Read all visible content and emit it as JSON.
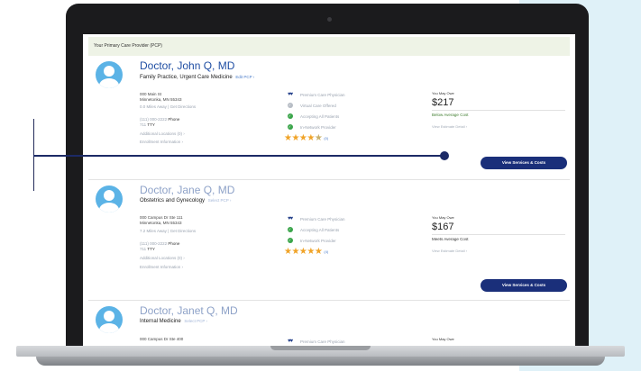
{
  "pcp_header": "Your Primary Care Provider (PCP)",
  "providers": [
    {
      "name": "Doctor, John Q, MD",
      "specialty": "Family Practice, Urgent Care Medicine",
      "pcp_link": "Edit PCP ›",
      "address_line1": "000 Main St",
      "address_line2": "Minnetonka, MN 55343",
      "distance": "0.0 Miles Away | Get Directions",
      "phone": "(111) 000-2222",
      "phone_label": "Phone",
      "tty": "711",
      "tty_label": "TTY",
      "additional_locations": "Additional Locations (0) ›",
      "enrollment": "Enrollment Information ›",
      "features": [
        "Premium Care Physician",
        "Virtual Care Offered",
        "Accepting All Patients",
        "In-Network Provider"
      ],
      "rating_count": "(0)",
      "rating": 4.5,
      "owe_label": "You May Owe",
      "cost": "$217",
      "cost_note": "Below Average Cost",
      "estimate_link": "View Estimate Detail ›",
      "button": "View Services & Costs"
    },
    {
      "name": "Doctor, Jane Q, MD",
      "specialty": "Obstetrics and Gynecology",
      "pcp_link": "Select PCP ›",
      "address_line1": "000 Campus Dr Ste 111",
      "address_line2": "Minnetonka, MN 55343",
      "distance": "7.2 Miles Away | Get Directions",
      "phone": "(111) 000-2222",
      "phone_label": "Phone",
      "tty": "711",
      "tty_label": "TTY",
      "additional_locations": "Additional Locations (0) ›",
      "enrollment": "Enrollment Information ›",
      "features": [
        "Premium Care Physician",
        "Accepting All Patients",
        "In-Network Provider"
      ],
      "rating_count": "(4)",
      "rating": 5,
      "owe_label": "You May Owe",
      "cost": "$167",
      "cost_note": "Meets Average Cost",
      "estimate_link": "View Estimate Detail ›",
      "button": "View Services & Costs"
    },
    {
      "name": "Doctor, Janet Q, MD",
      "specialty": "Internal Medicine",
      "pcp_link": "Select PCP ›",
      "address_line1": "000 Campus Dr Ste 400",
      "features": [
        "Premium Care Physician"
      ],
      "owe_label": "You May Owe"
    }
  ],
  "colors": {
    "brand_blue": "#1f4ea3",
    "button": "#1a2f7a",
    "star": "#f0a327",
    "check": "#3aa54a",
    "header_bg": "#eef3e6"
  }
}
